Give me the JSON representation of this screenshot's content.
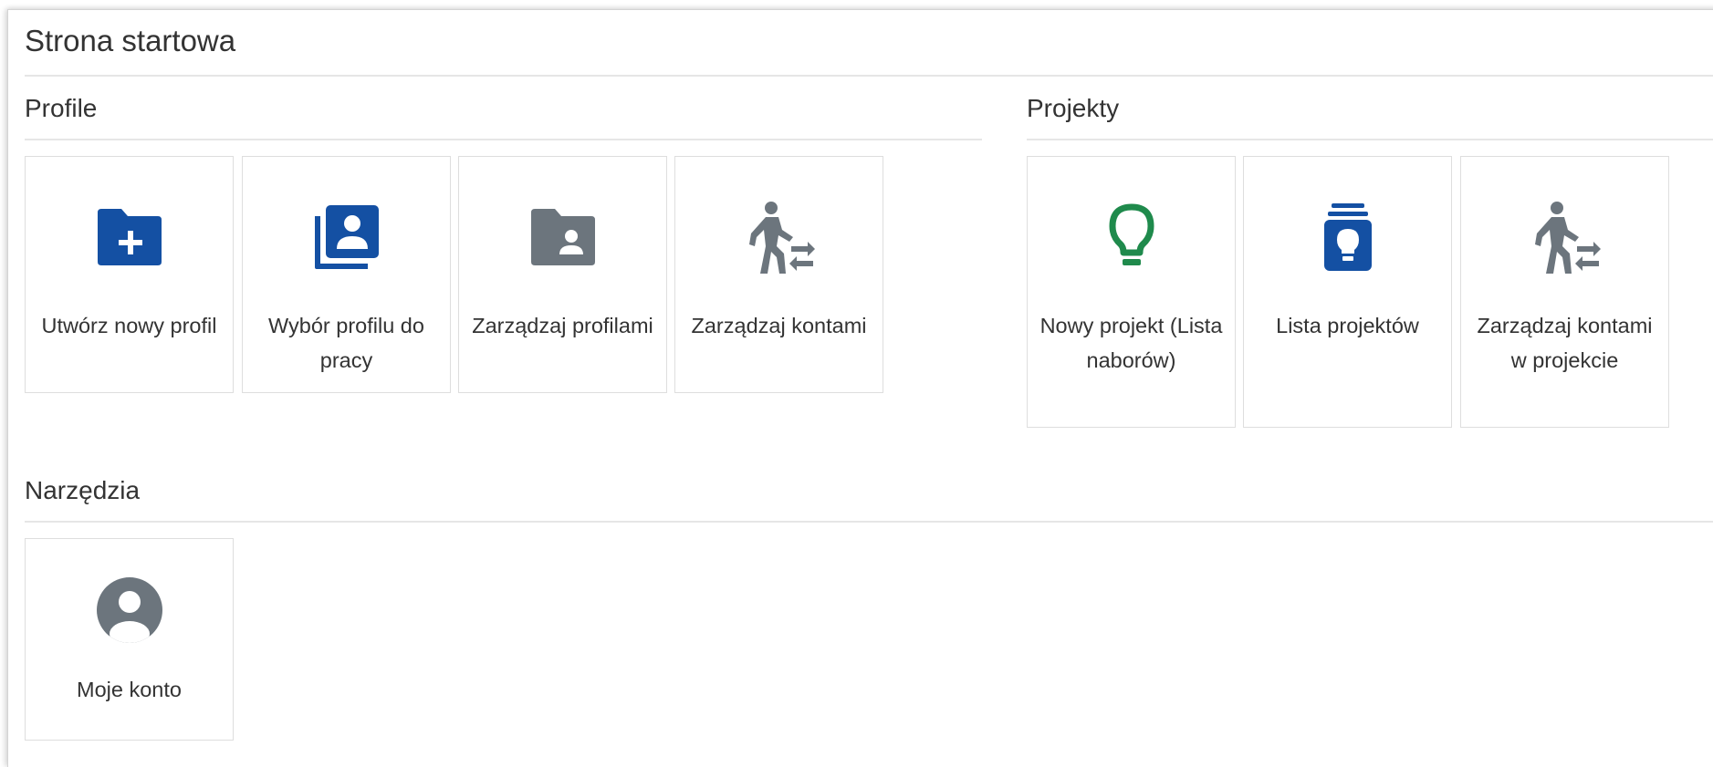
{
  "page": {
    "title": "Strona startowa"
  },
  "colors": {
    "blue_icon": "#1450a3",
    "gray_icon": "#6c757d",
    "green_icon": "#1f8a4c",
    "text": "#333333",
    "divider": "#e6e6e6",
    "tile_border": "#dedede"
  },
  "sections": {
    "profile": {
      "title": "Profile",
      "tiles": [
        {
          "label": "Utwórz nowy profil",
          "icon": "folder-plus-icon"
        },
        {
          "label": "Wybór profilu do pracy",
          "icon": "profile-stack-icon"
        },
        {
          "label": "Zarządzaj profilami",
          "icon": "folder-user-icon"
        },
        {
          "label": "Zarządzaj kontami",
          "icon": "walk-exchange-icon"
        }
      ]
    },
    "projekty": {
      "title": "Projekty",
      "tiles": [
        {
          "label": "Nowy projekt (Lista naborów)",
          "icon": "lightbulb-icon"
        },
        {
          "label": "Lista projektów",
          "icon": "idea-archive-icon"
        },
        {
          "label": "Zarządzaj kontami w projekcie",
          "icon": "walk-exchange-icon"
        }
      ]
    },
    "narzedzia": {
      "title": "Narzędzia",
      "tiles": [
        {
          "label": "Moje konto",
          "icon": "account-circle-icon"
        }
      ]
    }
  }
}
